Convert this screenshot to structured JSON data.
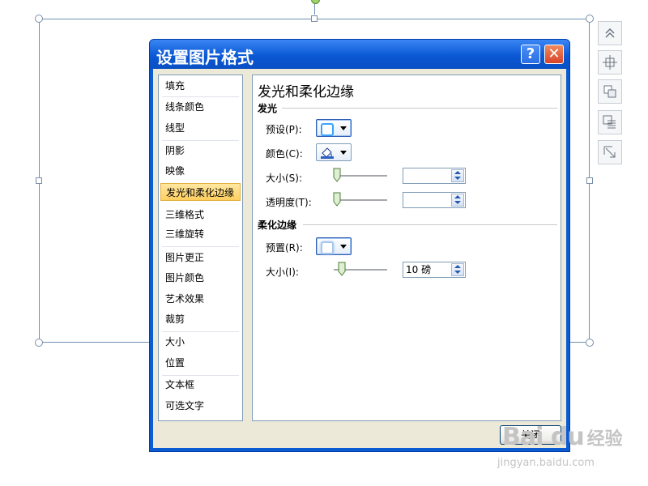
{
  "dialog": {
    "title": "设置图片格式",
    "help_label": "?",
    "close_label": "✕",
    "close_button_label": "关闭"
  },
  "categories": [
    {
      "label": "填充"
    },
    {
      "label": "线条颜色"
    },
    {
      "label": "线型"
    },
    {
      "label": "阴影"
    },
    {
      "label": "映像"
    },
    {
      "label": "发光和柔化边缘",
      "selected": true
    },
    {
      "label": "三维格式"
    },
    {
      "label": "三维旋转"
    },
    {
      "label": "图片更正"
    },
    {
      "label": "图片颜色"
    },
    {
      "label": "艺术效果"
    },
    {
      "label": "裁剪"
    },
    {
      "label": "大小"
    },
    {
      "label": "位置"
    },
    {
      "label": "文本框"
    },
    {
      "label": "可选文字"
    }
  ],
  "panel": {
    "title": "发光和柔化边缘",
    "glow": {
      "section_title": "发光",
      "preset_label": "预设(P):",
      "color_label": "颜色(C):",
      "size_label": "大小(S):",
      "size_value": "",
      "transparency_label": "透明度(T):",
      "transparency_value": ""
    },
    "soft_edges": {
      "section_title": "柔化边缘",
      "preset_label": "预置(R):",
      "size_label": "大小(I):",
      "size_value": "10 磅"
    }
  },
  "colors": {
    "title_bar": "#0a58d4",
    "selected_category": "#ffcf5e",
    "selection_frame": "#6e8fb5"
  },
  "watermark": {
    "logo": "Bai du",
    "text": "经验",
    "url": "jingyan.baidu.com"
  },
  "mini_toolbar_icons": [
    "chevrons-up-icon",
    "align-center-icon",
    "bring-forward-icon",
    "wrap-text-icon",
    "resize-icon"
  ]
}
